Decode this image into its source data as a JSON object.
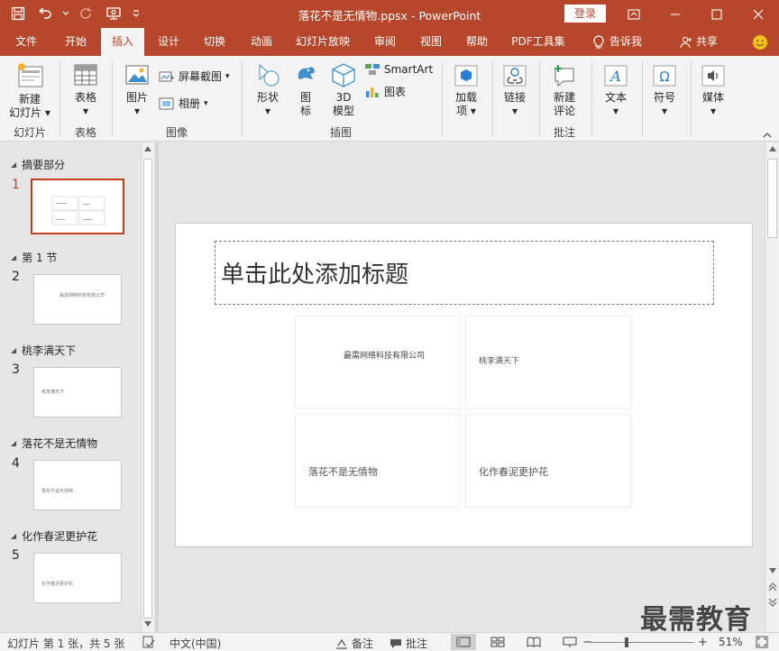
{
  "window": {
    "doc_title": "落花不是无情物.ppsx",
    "app_name": "PowerPoint",
    "login_label": "登录"
  },
  "tabs": [
    {
      "label": "文件"
    },
    {
      "label": "开始"
    },
    {
      "label": "插入"
    },
    {
      "label": "设计"
    },
    {
      "label": "切换"
    },
    {
      "label": "动画"
    },
    {
      "label": "幻灯片放映"
    },
    {
      "label": "审阅"
    },
    {
      "label": "视图"
    },
    {
      "label": "帮助"
    },
    {
      "label": "PDF工具集"
    }
  ],
  "tell_me": "告诉我",
  "share": "共享",
  "ribbon": {
    "new_slide_1": "新建",
    "new_slide_2": "幻灯片",
    "table": "表格",
    "picture": "图片",
    "screenshot": "屏幕截图",
    "album": "相册",
    "shapes": "形状",
    "icons_1": "图",
    "icons_2": "标",
    "model3d_1": "3D",
    "model3d_2": "模型",
    "smartart": "SmartArt",
    "chart": "图表",
    "addins_1": "加载",
    "addins_2": "项",
    "link": "链接",
    "new_comment_1": "新建",
    "new_comment_2": "评论",
    "text": "文本",
    "symbols": "符号",
    "media": "媒体",
    "groups": {
      "slides": "幻灯片",
      "tables": "表格",
      "images": "图像",
      "illustrations": "插图",
      "comments": "批注"
    }
  },
  "sections": [
    {
      "name": "摘要部分"
    },
    {
      "name": "第 1 节"
    },
    {
      "name": "桃李满天下"
    },
    {
      "name": "落花不是无情物"
    },
    {
      "name": "化作春泥更护花"
    }
  ],
  "slides": [
    {
      "num": "1"
    },
    {
      "num": "2",
      "thumb_text": "最需网络科技有限公司"
    },
    {
      "num": "3",
      "thumb_text": "桃李满天下"
    },
    {
      "num": "4",
      "thumb_text": "落花不是无情物"
    },
    {
      "num": "5",
      "thumb_text": "化作春泥更护花"
    }
  ],
  "slide": {
    "title_placeholder": "单击此处添加标题",
    "cells": [
      {
        "text": "最需网络科技有限公司"
      },
      {
        "text": "桃李满天下"
      },
      {
        "text": "落花不是无情物"
      },
      {
        "text": "化作春泥更护花"
      }
    ]
  },
  "watermark": "最需教育",
  "status": {
    "slide_info": "幻灯片 第 1 张，共 5 张",
    "language": "中文(中国)",
    "notes": "备注",
    "comments": "批注",
    "zoom": "51%"
  },
  "colors": {
    "accent": "#b7472a",
    "selected": "#c43e1c"
  }
}
